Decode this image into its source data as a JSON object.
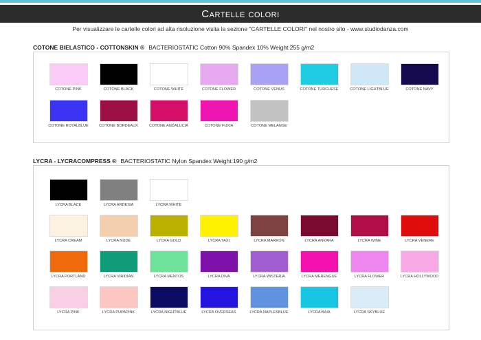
{
  "header": {
    "title": "Cartelle colori"
  },
  "subtitle": "Per visualizzare le cartelle colori ad alta risoluzione visita la sezione \"CARTELLE COLORI\" nel nostro sito - www.studiodanza.com",
  "sections": [
    {
      "name": "COTONE BIELASTICO - COTTONSKIN ®",
      "details": "BACTERIOSTATIC   Cotton 90% Spandex 10%   Weight:255 g/m2",
      "rows": [
        [
          {
            "label": "COTONE PINK",
            "color": "#f9ccf6"
          },
          {
            "label": "COTONE BLACK",
            "color": "#000000"
          },
          {
            "label": "COTONE WHITE",
            "color": "#ffffff"
          },
          {
            "label": "COTONE FLOWER",
            "color": "#e6a8ee"
          },
          {
            "label": "COTONE VENUS",
            "color": "#a9a2f4"
          },
          {
            "label": "COTONE TURCHESE",
            "color": "#1fcde3"
          },
          {
            "label": "COTONE LIGHTBLUE",
            "color": "#cfe8f7"
          },
          {
            "label": "COTONE NAVY",
            "color": "#150a4e"
          }
        ],
        [
          {
            "label": "COTONE ROYALBLUE",
            "color": "#3a34f2"
          },
          {
            "label": "COTONE BORDEAUX",
            "color": "#9c0f45"
          },
          {
            "label": "COTONE ANDALUCIA",
            "color": "#d40f6a"
          },
          {
            "label": "COTONE FUXIA",
            "color": "#ef15b3"
          },
          {
            "label": "COTONE MELANGE",
            "color": "#c2c2c2"
          }
        ]
      ]
    },
    {
      "name": "LYCRA - LYCRACOMPRESS ®",
      "details": "BACTERIOSTATIC   Nylon Spandex   Weight:190 g/m2",
      "rows": [
        [
          {
            "label": "LYCRA BLACK",
            "color": "#000000"
          },
          {
            "label": "LYCRA ARDESIA",
            "color": "#808080"
          },
          {
            "label": "LYCRA WHITE",
            "color": "#ffffff"
          }
        ],
        [
          {
            "label": "LYCRA CREAM",
            "color": "#fbf3e0"
          },
          {
            "label": "LYCRA NUDE",
            "color": "#f3cfae"
          },
          {
            "label": "LYCRA GOLD",
            "color": "#b9b000"
          },
          {
            "label": "LYCRA TAXI",
            "color": "#fff200"
          },
          {
            "label": "LYCRA MARRON",
            "color": "#7e4340"
          },
          {
            "label": "LYCRA ANKARA",
            "color": "#7b0a30"
          },
          {
            "label": "LYCRA WINE",
            "color": "#b00e46"
          },
          {
            "label": "LYCRA VENERE",
            "color": "#df0c0c"
          }
        ],
        [
          {
            "label": "LYCRA PORTLAND",
            "color": "#f06a0c"
          },
          {
            "label": "LYCRA VIRIDIAN",
            "color": "#0f9c79"
          },
          {
            "label": "LYCRA MENTOS",
            "color": "#6fe29a"
          },
          {
            "label": "LYCRA DIVA",
            "color": "#7d10a8"
          },
          {
            "label": "LYCRA WISTERIA",
            "color": "#a15ed3"
          },
          {
            "label": "LYCRA MERENGUE",
            "color": "#f411b0"
          },
          {
            "label": "LYCRA FLOWER",
            "color": "#ed86ef"
          },
          {
            "label": "LYCRA HOLLYWOOD",
            "color": "#f9a9e6"
          }
        ],
        [
          {
            "label": "LYCRA PINK",
            "color": "#f9cfe6"
          },
          {
            "label": "LYCRA PUPAPINK",
            "color": "#fbc7c0"
          },
          {
            "label": "LYCRA NIGHTBLUE",
            "color": "#0c0c63"
          },
          {
            "label": "LYCRA OVERSEAS",
            "color": "#2414e0"
          },
          {
            "label": "LYCRA NAPLESBLUE",
            "color": "#5f93e0"
          },
          {
            "label": "LYCRA BAIA",
            "color": "#17c6e3"
          },
          {
            "label": "LYCRA SKYBLUE",
            "color": "#d8edf8"
          }
        ]
      ]
    }
  ]
}
